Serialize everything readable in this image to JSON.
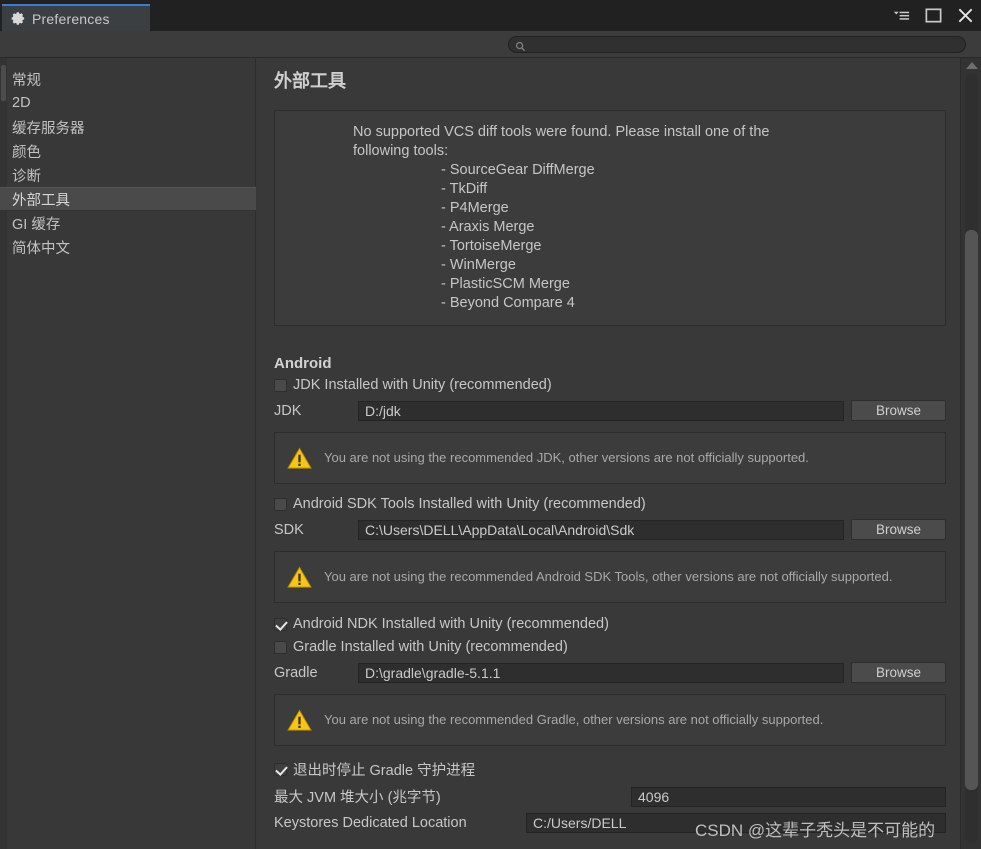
{
  "window": {
    "tab_title": "Preferences",
    "tab_icon": "gear-icon",
    "accent_color": "#3a7cd0",
    "background_color": "#393939",
    "controls": [
      {
        "name": "window-menu-icon",
        "glyph": "menu"
      },
      {
        "name": "maximize-icon",
        "glyph": "square"
      },
      {
        "name": "close-icon",
        "glyph": "x"
      }
    ]
  },
  "search": {
    "icon": "search-icon",
    "value": "",
    "placeholder": ""
  },
  "sidebar": {
    "items": [
      {
        "label": "常规",
        "selected": false
      },
      {
        "label": "2D",
        "selected": false
      },
      {
        "label": "缓存服务器",
        "selected": false
      },
      {
        "label": "颜色",
        "selected": false
      },
      {
        "label": "诊断",
        "selected": false
      },
      {
        "label": "外部工具",
        "selected": true
      },
      {
        "label": "GI 缓存",
        "selected": false
      },
      {
        "label": "简体中文",
        "selected": false
      }
    ]
  },
  "panel": {
    "title": "外部工具",
    "vcs_notice": {
      "line1": "No supported VCS diff tools were found. Please install one of the",
      "line2": "following tools:",
      "tools": [
        "- SourceGear DiffMerge",
        "- TkDiff",
        "- P4Merge",
        "- Araxis Merge",
        "- TortoiseMerge",
        "- WinMerge",
        "- PlasticSCM Merge",
        "- Beyond Compare 4"
      ]
    },
    "android": {
      "section_label": "Android",
      "jdk_checkbox_label": "JDK Installed with Unity (recommended)",
      "jdk_checked": false,
      "jdk_field_label": "JDK",
      "jdk_value": "D:/jdk",
      "jdk_browse": "Browse",
      "jdk_warning": "You are not using the recommended JDK, other versions are not officially supported.",
      "sdk_checkbox_label": "Android SDK Tools Installed with Unity (recommended)",
      "sdk_checked": false,
      "sdk_field_label": "SDK",
      "sdk_value": "C:\\Users\\DELL\\AppData\\Local\\Android\\Sdk",
      "sdk_browse": "Browse",
      "sdk_warning": "You are not using the recommended Android SDK Tools, other versions are not officially supported.",
      "ndk_checkbox_label": "Android NDK Installed with Unity (recommended)",
      "ndk_checked": true,
      "gradle_checkbox_label": "Gradle Installed with Unity (recommended)",
      "gradle_checked": false,
      "gradle_field_label": "Gradle",
      "gradle_value": "D:\\gradle\\gradle-5.1.1",
      "gradle_browse": "Browse",
      "gradle_warning": "You are not using the recommended Gradle, other versions are not officially supported.",
      "stop_daemon_label": "退出时停止 Gradle 守护进程",
      "stop_daemon_checked": true,
      "jvm_heap_label": "最大 JVM 堆大小 (兆字节)",
      "jvm_heap_value": "4096",
      "keystores_label": "Keystores Dedicated Location",
      "keystores_value": "C:/Users/DELL"
    },
    "warning_icon": "warning-triangle-icon",
    "warning_color": "#f5c518"
  },
  "scrollbars": {
    "vertical_name": "panel-vertical-scrollbar",
    "sidebar_name": "sidebar-scrollbar"
  },
  "watermark": {
    "text": "CSDN @这辈子秃头是不可能的"
  }
}
